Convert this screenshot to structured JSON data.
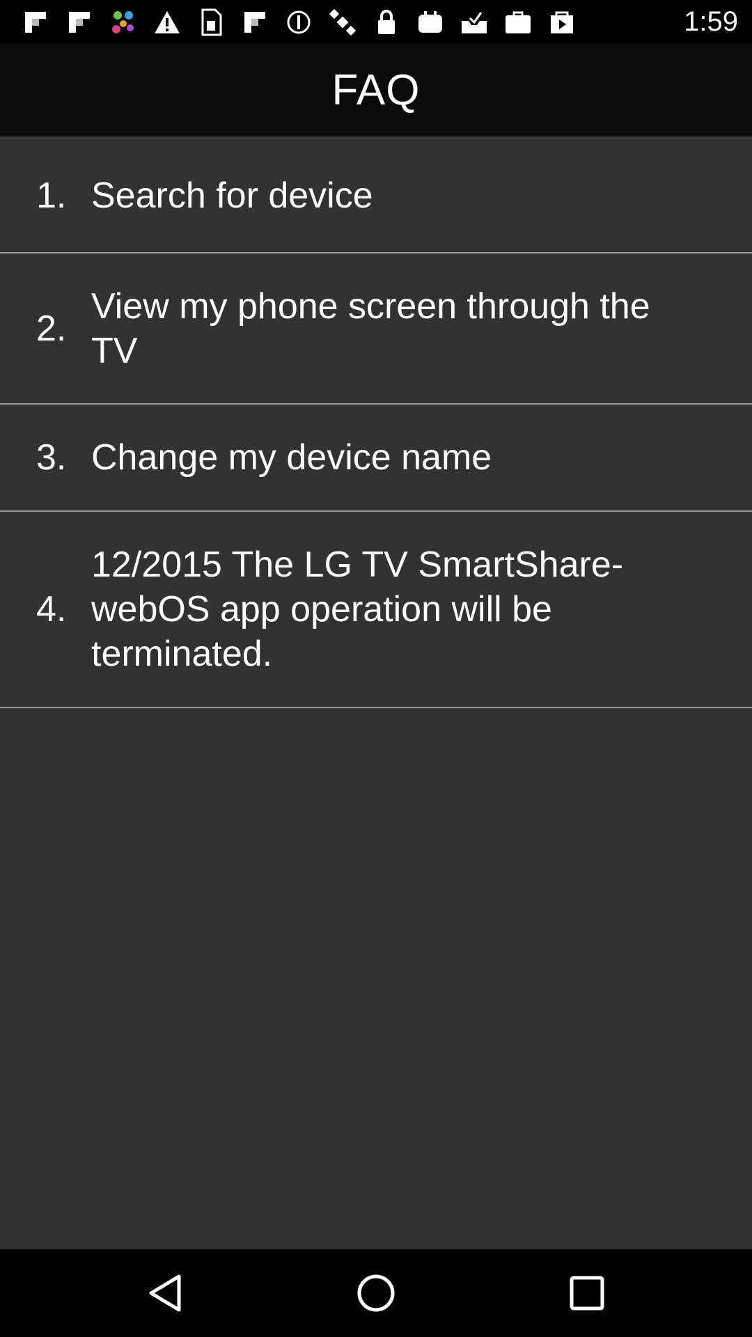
{
  "status_bar": {
    "time": "1:59",
    "left_icons": [
      "flipboard-icon",
      "flipboard-icon",
      "app-dots-icon",
      "warning-icon",
      "sim-card-icon",
      "flipboard-icon",
      "block-icon",
      "satellite-icon",
      "lock-icon",
      "tv-icon",
      "inbox-icon",
      "briefcase-icon",
      "play-store-icon"
    ]
  },
  "header": {
    "title": "FAQ"
  },
  "faq": {
    "items": [
      {
        "number": "1.",
        "text": "Search for device"
      },
      {
        "number": "2.",
        "text": "View my phone screen through the TV"
      },
      {
        "number": "3.",
        "text": "Change my device name"
      },
      {
        "number": "4.",
        "text": "12/2015 The LG TV SmartShare-webOS app operation will be terminated."
      }
    ]
  },
  "nav_bar": {
    "buttons": [
      "back-icon",
      "home-icon",
      "recents-icon"
    ]
  },
  "colors": {
    "background": "#323232",
    "title_bar": "#0b0b0b",
    "status_bar": "#000000",
    "divider": "#9a9a9a",
    "text": "#ffffff"
  }
}
